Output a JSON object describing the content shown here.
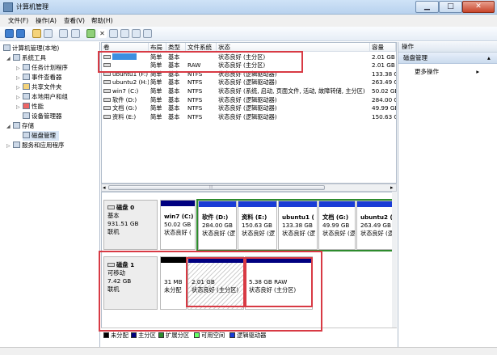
{
  "window": {
    "title": "计算机管理",
    "min": "▁",
    "max": "□",
    "close": "✕"
  },
  "menu": [
    "文件(F)",
    "操作(A)",
    "查看(V)",
    "帮助(H)"
  ],
  "tree": {
    "root": "计算机管理(本地)",
    "items": [
      "系统工具",
      "任务计划程序",
      "事件查看器",
      "共享文件夹",
      "本地用户和组",
      "性能",
      "设备管理器",
      "存储",
      "磁盘管理",
      "服务和应用程序"
    ]
  },
  "table": {
    "headers": [
      "卷",
      "布局",
      "类型",
      "文件系统",
      "状态",
      "容量"
    ],
    "rows": [
      [
        "",
        "简单",
        "基本",
        "",
        "状态良好 (主分区)",
        "2.01 GB"
      ],
      [
        "",
        "简单",
        "基本",
        "RAW",
        "状态良好 (主分区)",
        "2.01 GB"
      ],
      [
        "ubuntu1 (F:)",
        "简单",
        "基本",
        "NTFS",
        "状态良好 (逻辑驱动器)",
        "133.38 G"
      ],
      [
        "ubuntu2 (H:)",
        "简单",
        "基本",
        "NTFS",
        "状态良好 (逻辑驱动器)",
        "263.49 G"
      ],
      [
        "win7 (C:)",
        "简单",
        "基本",
        "NTFS",
        "状态良好 (系统, 启动, 页面文件, 活动, 故障转储, 主分区)",
        "50.02 GE"
      ],
      [
        "软件 (D:)",
        "简单",
        "基本",
        "NTFS",
        "状态良好 (逻辑驱动器)",
        "284.00 G"
      ],
      [
        "文档 (G:)",
        "简单",
        "基本",
        "NTFS",
        "状态良好 (逻辑驱动器)",
        "49.99 GE"
      ],
      [
        "资料 (E:)",
        "简单",
        "基本",
        "NTFS",
        "状态良好 (逻辑驱动器)",
        "150.63 G"
      ]
    ],
    "scroll_left": "◂",
    "scroll_grip": "⦙⦙⦙",
    "scroll_right": "▸"
  },
  "disk0": {
    "name": "磁盘 0",
    "type": "基本",
    "size": "931.51 GB",
    "status": "联机",
    "partitions": [
      {
        "name": "win7 (C:)",
        "size": "50.02 GB",
        "status": "状态良好 ("
      },
      {
        "name": "软件 (D:)",
        "size": "284.00 GB",
        "status": "状态良好 (逻"
      },
      {
        "name": "资料 (E:)",
        "size": "150.63 GB",
        "status": "状态良好 (逻"
      },
      {
        "name": "ubuntu1 (",
        "size": "133.38 GB",
        "status": "状态良好 (逻"
      },
      {
        "name": "文档 (G:)",
        "size": "49.99 GB",
        "status": "状态良好 (逻"
      },
      {
        "name": "ubuntu2 (",
        "size": "263.49 GB",
        "status": "状态良好 (逻"
      }
    ]
  },
  "disk1": {
    "name": "磁盘 1",
    "type": "可移动",
    "size": "7.42 GB",
    "status": "联机",
    "partitions": [
      {
        "name": "",
        "size": "31 MB",
        "status": "未分配"
      },
      {
        "name": "",
        "size": "2.01 GB",
        "status": "状态良好 (主分区)"
      },
      {
        "name": "",
        "size": "5.38 GB RAW",
        "status": "状态良好 (主分区)"
      }
    ]
  },
  "legend": [
    "未分配",
    "主分区",
    "扩展分区",
    "可用空间",
    "逻辑驱动器"
  ],
  "legend_colors": [
    "#000000",
    "#000080",
    "#2e8b2e",
    "#66ff66",
    "#1a3cd6"
  ],
  "actions": {
    "header": "操作",
    "section": "磁盘管理",
    "more": "更多操作",
    "section_arrow": "▴",
    "more_arrow": "▸"
  },
  "colors": {
    "primary": "#000080",
    "logical": "#1a3cd6",
    "unallocated": "#000000",
    "extended": "#2e8b2e",
    "highlight": "#d83a44"
  }
}
